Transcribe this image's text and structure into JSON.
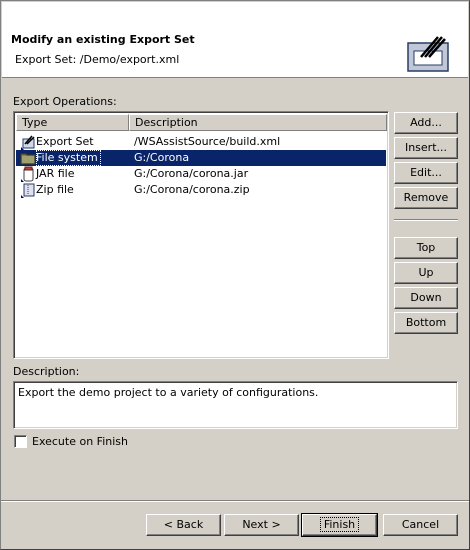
{
  "header": {
    "title": "Modify an existing Export Set",
    "subtitle": "Export Set: /Demo/export.xml",
    "icon": "export-set-wizard-icon"
  },
  "operations": {
    "label": "Export Operations:",
    "columns": [
      "Type",
      "Description"
    ],
    "rows": [
      {
        "type": "Export Set",
        "description": "/WSAssistSource/build.xml",
        "icon": "export-set-icon",
        "selected": false
      },
      {
        "type": "File system",
        "description": "G:/Corona",
        "icon": "folder-icon",
        "selected": true
      },
      {
        "type": "JAR file",
        "description": "G:/Corona/corona.jar",
        "icon": "jar-icon",
        "selected": false
      },
      {
        "type": "Zip file",
        "description": "G:/Corona/corona.zip",
        "icon": "zip-icon",
        "selected": false
      }
    ]
  },
  "side_buttons": {
    "add": "Add...",
    "insert": "Insert...",
    "edit": "Edit...",
    "remove": "Remove",
    "top": "Top",
    "up": "Up",
    "down": "Down",
    "bottom": "Bottom"
  },
  "description": {
    "label": "Description:",
    "value": "Export the demo project to a variety of configurations."
  },
  "execute_on_finish": {
    "label": "Execute on Finish",
    "checked": false
  },
  "footer": {
    "back": "< Back",
    "next": "Next >",
    "finish": "Finish",
    "cancel": "Cancel"
  },
  "colors": {
    "selection": "#0a246a",
    "dialog_bg": "#d4d0c8"
  }
}
